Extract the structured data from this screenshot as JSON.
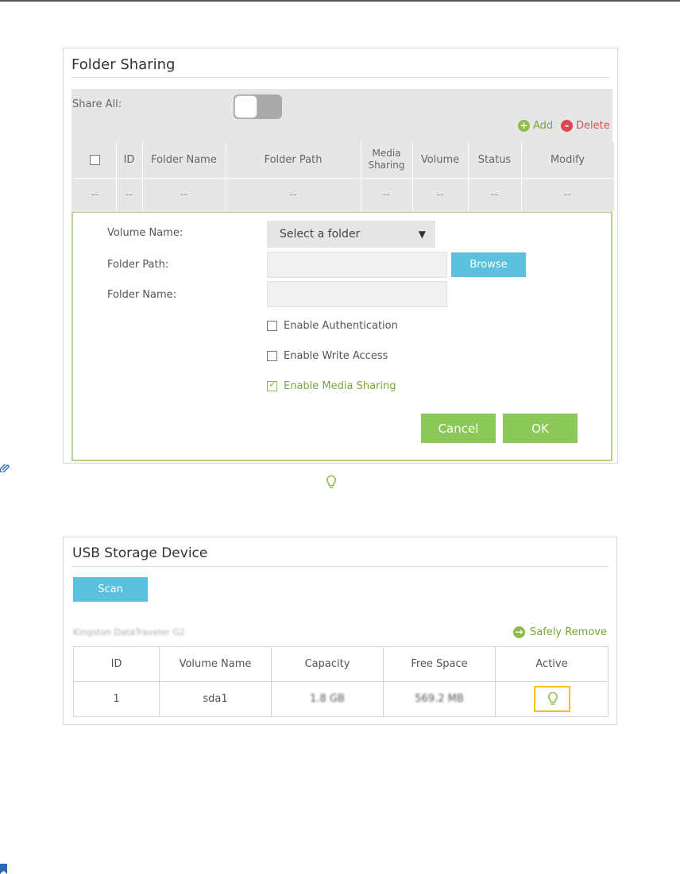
{
  "folder_sharing": {
    "title": "Folder Sharing",
    "share_all_label": "Share All:",
    "share_all_enabled": false,
    "add_label": "Add",
    "delete_label": "Delete",
    "table": {
      "headers": [
        "ID",
        "Folder Name",
        "Folder Path",
        "Media Sharing",
        "Volume",
        "Status",
        "Modify"
      ],
      "row": [
        "--",
        "--",
        "--",
        "--",
        "--",
        "--",
        "--",
        "--"
      ]
    },
    "form": {
      "volume_name_label": "Volume Name:",
      "volume_select_value": "Select a folder",
      "folder_path_label": "Folder Path:",
      "folder_path_value": "",
      "browse_label": "Browse",
      "folder_name_label": "Folder Name:",
      "folder_name_value": "",
      "enable_auth_label": "Enable Authentication",
      "enable_auth_checked": false,
      "enable_write_label": "Enable Write Access",
      "enable_write_checked": false,
      "enable_media_label": "Enable Media Sharing",
      "enable_media_checked": true,
      "cancel_label": "Cancel",
      "ok_label": "OK"
    }
  },
  "usb_storage": {
    "title": "USB Storage Device",
    "scan_label": "Scan",
    "device_name": "Kingston DataTraveler G2",
    "safely_remove_label": "Safely Remove",
    "table": {
      "headers": [
        "ID",
        "Volume Name",
        "Capacity",
        "Free Space",
        "Active"
      ],
      "row": {
        "id": "1",
        "volume_name": "sda1",
        "capacity": "1.8 GB",
        "free_space": "569.2 MB"
      }
    }
  },
  "colors": {
    "accent_green": "#8cc75a",
    "accent_blue": "#5bc0de",
    "delete_red": "#e0454a",
    "highlight_yellow": "#f2c21a"
  }
}
